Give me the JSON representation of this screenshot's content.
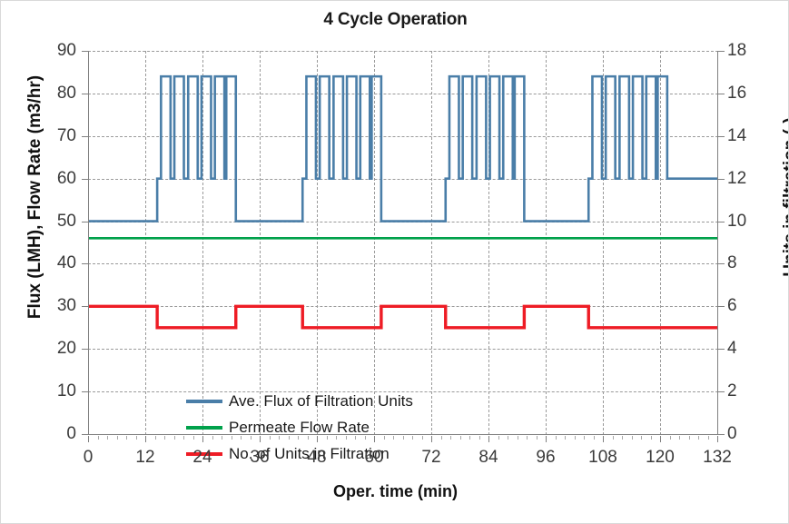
{
  "chart_data": {
    "type": "line",
    "title": "4 Cycle Operation",
    "xlabel": "Oper. time (min)",
    "ylabel": "Flux (LMH), Flow Rate (m3/hr)",
    "ylabel_secondary": "Units in filtration (-)",
    "xlim": [
      0,
      132
    ],
    "ylim": [
      0,
      90
    ],
    "ylim_secondary": [
      0,
      18
    ],
    "xticks": [
      0,
      12,
      24,
      36,
      48,
      60,
      72,
      84,
      96,
      108,
      120,
      132
    ],
    "yticks": [
      0,
      10,
      20,
      30,
      40,
      50,
      60,
      70,
      80,
      90
    ],
    "yticks_secondary": [
      0,
      2,
      4,
      6,
      8,
      10,
      12,
      14,
      16,
      18
    ],
    "x_minor_tick_interval": 2,
    "grid": true,
    "grid_style": "dashed",
    "legend_position": "inside-lower-left",
    "series": [
      {
        "name": "Ave. Flux of Filtration Units",
        "color": "#4A7EA8",
        "axis": "left",
        "step_style": "square-wave",
        "baseline_value": 50,
        "plateau_value": 60,
        "spike_value": 84,
        "spikes_per_burst": 6,
        "bursts": [
          {
            "start": 14.5,
            "end": 31.0
          },
          {
            "start": 45.0,
            "end": 61.5
          },
          {
            "start": 75.0,
            "end": 91.5
          },
          {
            "start": 105.0,
            "end": 132.0
          }
        ],
        "points": [
          [
            0,
            50
          ],
          [
            14.5,
            50
          ],
          [
            14.5,
            60
          ],
          [
            15.3,
            60
          ],
          [
            15.3,
            84
          ],
          [
            17.3,
            84
          ],
          [
            17.3,
            60
          ],
          [
            18.1,
            60
          ],
          [
            18.1,
            84
          ],
          [
            20.1,
            84
          ],
          [
            20.1,
            60
          ],
          [
            21.0,
            60
          ],
          [
            21.0,
            84
          ],
          [
            23.0,
            84
          ],
          [
            23.0,
            60
          ],
          [
            23.8,
            60
          ],
          [
            23.8,
            84
          ],
          [
            25.8,
            84
          ],
          [
            25.8,
            60
          ],
          [
            26.6,
            60
          ],
          [
            26.6,
            84
          ],
          [
            28.6,
            84
          ],
          [
            28.6,
            60
          ],
          [
            29.0,
            60
          ],
          [
            29.0,
            84
          ],
          [
            31.0,
            84
          ],
          [
            31.0,
            60
          ],
          [
            31.0,
            50
          ],
          [
            45.0,
            50
          ],
          [
            45.0,
            60
          ],
          [
            45.8,
            60
          ],
          [
            45.8,
            84
          ],
          [
            47.8,
            84
          ],
          [
            47.8,
            60
          ],
          [
            48.6,
            60
          ],
          [
            48.6,
            84
          ],
          [
            50.6,
            84
          ],
          [
            50.6,
            60
          ],
          [
            51.5,
            60
          ],
          [
            51.5,
            84
          ],
          [
            53.5,
            84
          ],
          [
            53.5,
            60
          ],
          [
            54.3,
            60
          ],
          [
            54.3,
            84
          ],
          [
            56.3,
            84
          ],
          [
            56.3,
            60
          ],
          [
            57.1,
            60
          ],
          [
            57.1,
            84
          ],
          [
            59.1,
            84
          ],
          [
            59.1,
            60
          ],
          [
            59.5,
            60
          ],
          [
            59.5,
            84
          ],
          [
            61.5,
            84
          ],
          [
            61.5,
            60
          ],
          [
            61.5,
            50
          ],
          [
            75.0,
            50
          ],
          [
            75.0,
            60
          ],
          [
            75.8,
            60
          ],
          [
            75.8,
            84
          ],
          [
            77.8,
            84
          ],
          [
            77.8,
            60
          ],
          [
            78.6,
            60
          ],
          [
            78.6,
            84
          ],
          [
            80.6,
            84
          ],
          [
            80.6,
            60
          ],
          [
            81.5,
            60
          ],
          [
            81.5,
            84
          ],
          [
            83.5,
            84
          ],
          [
            83.5,
            60
          ],
          [
            84.3,
            60
          ],
          [
            84.3,
            84
          ],
          [
            86.3,
            84
          ],
          [
            86.3,
            60
          ],
          [
            87.1,
            60
          ],
          [
            87.1,
            84
          ],
          [
            89.1,
            84
          ],
          [
            89.1,
            60
          ],
          [
            89.5,
            60
          ],
          [
            89.5,
            84
          ],
          [
            91.5,
            84
          ],
          [
            91.5,
            60
          ],
          [
            91.5,
            50
          ],
          [
            105.0,
            50
          ],
          [
            105.0,
            60
          ],
          [
            105.8,
            60
          ],
          [
            105.8,
            84
          ],
          [
            107.8,
            84
          ],
          [
            107.8,
            60
          ],
          [
            108.6,
            60
          ],
          [
            108.6,
            84
          ],
          [
            110.6,
            84
          ],
          [
            110.6,
            60
          ],
          [
            111.5,
            60
          ],
          [
            111.5,
            84
          ],
          [
            113.5,
            84
          ],
          [
            113.5,
            60
          ],
          [
            114.3,
            60
          ],
          [
            114.3,
            84
          ],
          [
            116.3,
            84
          ],
          [
            116.3,
            60
          ],
          [
            117.1,
            60
          ],
          [
            117.1,
            84
          ],
          [
            119.1,
            84
          ],
          [
            119.1,
            60
          ],
          [
            119.5,
            60
          ],
          [
            119.5,
            84
          ],
          [
            121.5,
            84
          ],
          [
            121.5,
            60
          ],
          [
            132.0,
            60
          ]
        ]
      },
      {
        "name": "Permeate Flow Rate",
        "color": "#00A14B",
        "axis": "left",
        "constant_value": 46,
        "points": [
          [
            0,
            46
          ],
          [
            132,
            46
          ]
        ]
      },
      {
        "name": "No. of Units in Filtration",
        "color": "#EE1C25",
        "axis": "right",
        "high_value_units": 6,
        "low_value_units": 5,
        "high_value_left_scale": 30,
        "low_value_left_scale": 25,
        "points": [
          [
            0,
            6
          ],
          [
            14.5,
            6
          ],
          [
            14.5,
            5
          ],
          [
            31.0,
            5
          ],
          [
            31.0,
            6
          ],
          [
            45.0,
            6
          ],
          [
            45.0,
            5
          ],
          [
            61.5,
            5
          ],
          [
            61.5,
            6
          ],
          [
            75.0,
            6
          ],
          [
            75.0,
            5
          ],
          [
            91.5,
            5
          ],
          [
            91.5,
            6
          ],
          [
            105.0,
            6
          ],
          [
            105.0,
            5
          ],
          [
            132.0,
            5
          ]
        ]
      }
    ]
  },
  "legend": {
    "items": [
      {
        "label": "Ave. Flux of Filtration Units",
        "color": "#4A7EA8"
      },
      {
        "label": "Permeate Flow Rate",
        "color": "#00A14B"
      },
      {
        "label": "No. of Units in Filtration",
        "color": "#EE1C25"
      }
    ]
  }
}
